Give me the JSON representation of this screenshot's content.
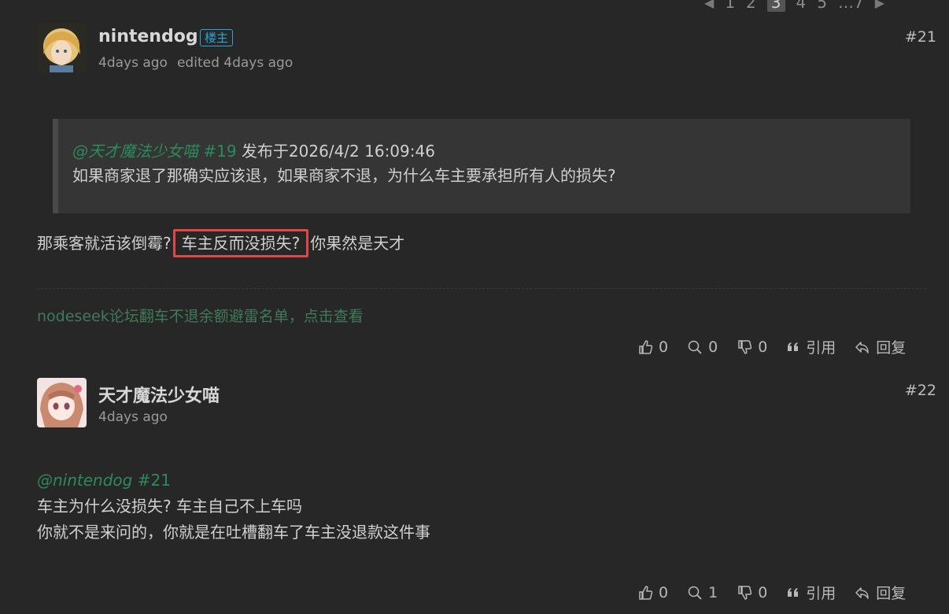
{
  "pagination": {
    "prev": "◀",
    "pages": [
      "1",
      "2",
      "3",
      "4",
      "5"
    ],
    "current": "3",
    "more": "…7",
    "next": "▶"
  },
  "posts": [
    {
      "username": "nintendog",
      "badge": "楼主",
      "time": "4days ago",
      "edited": "edited 4days ago",
      "floor": "#21",
      "quote": {
        "mention": "@天才魔法少女喵",
        "ref": "#19",
        "posted": "发布于2026/4/2 16:09:46",
        "text": "如果商家退了那确实应该退，如果商家不退，为什么车主要承担所有人的损失?"
      },
      "body_before": "那乘客就活该倒霉?",
      "body_highlight": "车主反而没损失?",
      "body_after": "你果然是天才",
      "signature": "nodeseek论坛翻车不退余额避雷名单，点击查看",
      "actions": {
        "like": "0",
        "search": "0",
        "dislike": "0",
        "quote": "引用",
        "reply": "回复"
      }
    },
    {
      "username": "天才魔法少女喵",
      "time": "4days ago",
      "floor": "#22",
      "mention": "@nintendog",
      "ref": "#21",
      "line1": "车主为什么没损失? 车主自己不上车吗",
      "line2": "你就不是来问的，你就是在吐槽翻车了车主没退款这件事",
      "actions": {
        "like": "0",
        "search": "1",
        "dislike": "0",
        "quote": "引用",
        "reply": "回复"
      }
    }
  ]
}
